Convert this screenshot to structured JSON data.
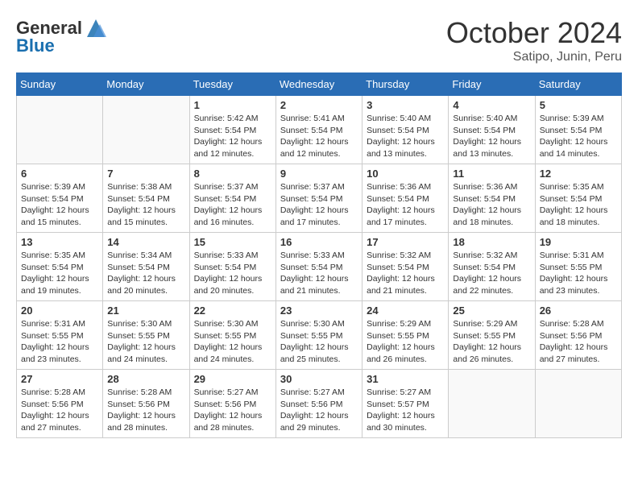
{
  "header": {
    "logo_general": "General",
    "logo_blue": "Blue",
    "month": "October 2024",
    "location": "Satipo, Junin, Peru"
  },
  "weekdays": [
    "Sunday",
    "Monday",
    "Tuesday",
    "Wednesday",
    "Thursday",
    "Friday",
    "Saturday"
  ],
  "weeks": [
    [
      {
        "day": "",
        "info": ""
      },
      {
        "day": "",
        "info": ""
      },
      {
        "day": "1",
        "info": "Sunrise: 5:42 AM\nSunset: 5:54 PM\nDaylight: 12 hours and 12 minutes."
      },
      {
        "day": "2",
        "info": "Sunrise: 5:41 AM\nSunset: 5:54 PM\nDaylight: 12 hours and 12 minutes."
      },
      {
        "day": "3",
        "info": "Sunrise: 5:40 AM\nSunset: 5:54 PM\nDaylight: 12 hours and 13 minutes."
      },
      {
        "day": "4",
        "info": "Sunrise: 5:40 AM\nSunset: 5:54 PM\nDaylight: 12 hours and 13 minutes."
      },
      {
        "day": "5",
        "info": "Sunrise: 5:39 AM\nSunset: 5:54 PM\nDaylight: 12 hours and 14 minutes."
      }
    ],
    [
      {
        "day": "6",
        "info": "Sunrise: 5:39 AM\nSunset: 5:54 PM\nDaylight: 12 hours and 15 minutes."
      },
      {
        "day": "7",
        "info": "Sunrise: 5:38 AM\nSunset: 5:54 PM\nDaylight: 12 hours and 15 minutes."
      },
      {
        "day": "8",
        "info": "Sunrise: 5:37 AM\nSunset: 5:54 PM\nDaylight: 12 hours and 16 minutes."
      },
      {
        "day": "9",
        "info": "Sunrise: 5:37 AM\nSunset: 5:54 PM\nDaylight: 12 hours and 17 minutes."
      },
      {
        "day": "10",
        "info": "Sunrise: 5:36 AM\nSunset: 5:54 PM\nDaylight: 12 hours and 17 minutes."
      },
      {
        "day": "11",
        "info": "Sunrise: 5:36 AM\nSunset: 5:54 PM\nDaylight: 12 hours and 18 minutes."
      },
      {
        "day": "12",
        "info": "Sunrise: 5:35 AM\nSunset: 5:54 PM\nDaylight: 12 hours and 18 minutes."
      }
    ],
    [
      {
        "day": "13",
        "info": "Sunrise: 5:35 AM\nSunset: 5:54 PM\nDaylight: 12 hours and 19 minutes."
      },
      {
        "day": "14",
        "info": "Sunrise: 5:34 AM\nSunset: 5:54 PM\nDaylight: 12 hours and 20 minutes."
      },
      {
        "day": "15",
        "info": "Sunrise: 5:33 AM\nSunset: 5:54 PM\nDaylight: 12 hours and 20 minutes."
      },
      {
        "day": "16",
        "info": "Sunrise: 5:33 AM\nSunset: 5:54 PM\nDaylight: 12 hours and 21 minutes."
      },
      {
        "day": "17",
        "info": "Sunrise: 5:32 AM\nSunset: 5:54 PM\nDaylight: 12 hours and 21 minutes."
      },
      {
        "day": "18",
        "info": "Sunrise: 5:32 AM\nSunset: 5:54 PM\nDaylight: 12 hours and 22 minutes."
      },
      {
        "day": "19",
        "info": "Sunrise: 5:31 AM\nSunset: 5:55 PM\nDaylight: 12 hours and 23 minutes."
      }
    ],
    [
      {
        "day": "20",
        "info": "Sunrise: 5:31 AM\nSunset: 5:55 PM\nDaylight: 12 hours and 23 minutes."
      },
      {
        "day": "21",
        "info": "Sunrise: 5:30 AM\nSunset: 5:55 PM\nDaylight: 12 hours and 24 minutes."
      },
      {
        "day": "22",
        "info": "Sunrise: 5:30 AM\nSunset: 5:55 PM\nDaylight: 12 hours and 24 minutes."
      },
      {
        "day": "23",
        "info": "Sunrise: 5:30 AM\nSunset: 5:55 PM\nDaylight: 12 hours and 25 minutes."
      },
      {
        "day": "24",
        "info": "Sunrise: 5:29 AM\nSunset: 5:55 PM\nDaylight: 12 hours and 26 minutes."
      },
      {
        "day": "25",
        "info": "Sunrise: 5:29 AM\nSunset: 5:55 PM\nDaylight: 12 hours and 26 minutes."
      },
      {
        "day": "26",
        "info": "Sunrise: 5:28 AM\nSunset: 5:56 PM\nDaylight: 12 hours and 27 minutes."
      }
    ],
    [
      {
        "day": "27",
        "info": "Sunrise: 5:28 AM\nSunset: 5:56 PM\nDaylight: 12 hours and 27 minutes."
      },
      {
        "day": "28",
        "info": "Sunrise: 5:28 AM\nSunset: 5:56 PM\nDaylight: 12 hours and 28 minutes."
      },
      {
        "day": "29",
        "info": "Sunrise: 5:27 AM\nSunset: 5:56 PM\nDaylight: 12 hours and 28 minutes."
      },
      {
        "day": "30",
        "info": "Sunrise: 5:27 AM\nSunset: 5:56 PM\nDaylight: 12 hours and 29 minutes."
      },
      {
        "day": "31",
        "info": "Sunrise: 5:27 AM\nSunset: 5:57 PM\nDaylight: 12 hours and 30 minutes."
      },
      {
        "day": "",
        "info": ""
      },
      {
        "day": "",
        "info": ""
      }
    ]
  ]
}
